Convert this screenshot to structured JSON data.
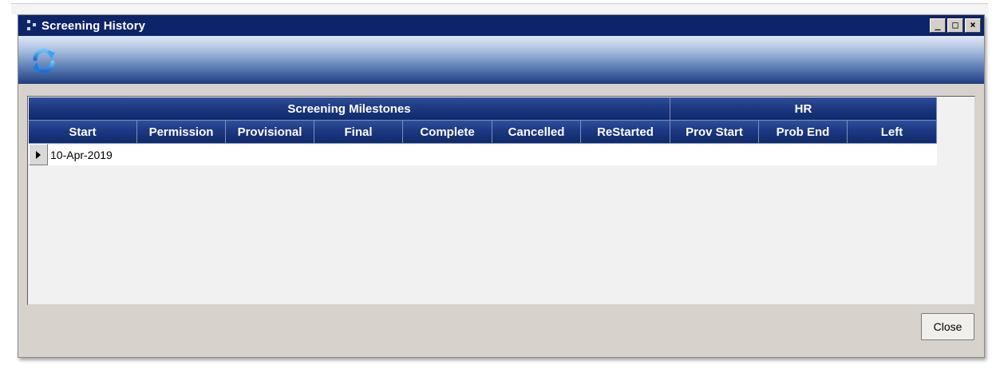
{
  "window": {
    "title": "Screening History",
    "controls": [
      "minimize",
      "restore",
      "close"
    ]
  },
  "toolbar": {
    "refresh_icon": "refresh-icon"
  },
  "grid": {
    "groups": [
      {
        "label": "Screening Milestones",
        "span": 8
      },
      {
        "label": "HR",
        "span": 3
      }
    ],
    "columns": [
      "Start",
      "Permission",
      "Provisional",
      "Final",
      "Complete",
      "Cancelled",
      "ReStarted",
      "Prov Start",
      "Prob End",
      "Left"
    ],
    "rows": [
      {
        "current": true,
        "cells": [
          "10-Apr-2019",
          "",
          "",
          "",
          "",
          "",
          "",
          "",
          "",
          ""
        ]
      }
    ]
  },
  "footer": {
    "close_label": "Close"
  },
  "colors": {
    "titlebar": "#0c246a",
    "header": "#1c3982",
    "refresh": "#1e90e8"
  }
}
